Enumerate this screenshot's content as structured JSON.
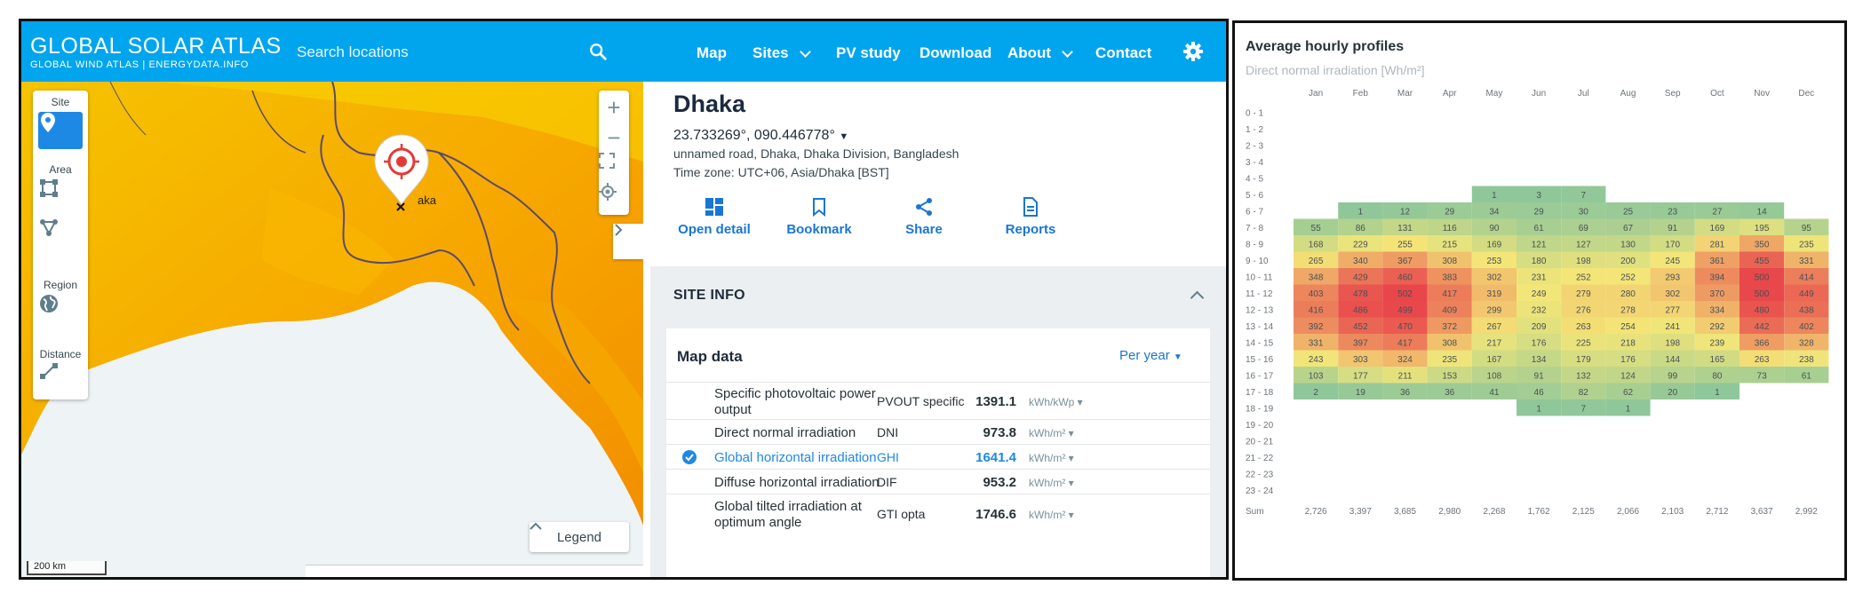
{
  "header": {
    "logo_title": "GLOBAL SOLAR ATLAS",
    "logo_sub": "GLOBAL WIND ATLAS  |  ENERGYDATA.INFO",
    "search_placeholder": "Search locations",
    "nav": [
      {
        "label": "Map",
        "dropdown": false
      },
      {
        "label": "Sites",
        "dropdown": true
      },
      {
        "label": "PV study",
        "dropdown": false
      },
      {
        "label": "Download",
        "dropdown": false
      },
      {
        "label": "About",
        "dropdown": true
      },
      {
        "label": "Contact",
        "dropdown": false
      }
    ],
    "accent_color": "#00a5ee"
  },
  "map": {
    "tools": {
      "site": "Site",
      "area": "Area",
      "region": "Region",
      "distance": "Distance"
    },
    "legend_label": "Legend",
    "scale_label": "200 km",
    "marker_label": "aka",
    "zoom_in": "+",
    "zoom_out": "−"
  },
  "site": {
    "city": "Dhaka",
    "coords": "23.733269°, 090.446778°",
    "address": "unnamed road, Dhaka, Dhaka Division, Bangladesh",
    "timezone": "Time zone: UTC+06, Asia/Dhaka [BST]",
    "actions": [
      "Open detail",
      "Bookmark",
      "Share",
      "Reports"
    ]
  },
  "site_info": {
    "title": "SITE INFO",
    "map_data_title": "Map data",
    "period": "Per year",
    "rows": [
      {
        "name1": "Specific photovoltaic power",
        "name2": "output",
        "abbr": "PVOUT specific",
        "value": "1391.1",
        "unit": "kWh/kWp",
        "highlight": false
      },
      {
        "name1": "Direct normal irradiation",
        "name2": "",
        "abbr": "DNI",
        "value": "973.8",
        "unit": "kWh/m²",
        "highlight": false
      },
      {
        "name1": "Global horizontal irradiation",
        "name2": "",
        "abbr": "GHI",
        "value": "1641.4",
        "unit": "kWh/m²",
        "highlight": true
      },
      {
        "name1": "Diffuse horizontal irradiation",
        "name2": "",
        "abbr": "DIF",
        "value": "953.2",
        "unit": "kWh/m²",
        "highlight": false
      },
      {
        "name1": "Global tilted irradiation at",
        "name2": "optimum angle",
        "abbr": "GTI opta",
        "value": "1746.6",
        "unit": "kWh/m²",
        "highlight": false
      }
    ]
  },
  "chart_data": {
    "type": "heatmap",
    "title": "Average hourly profiles",
    "subtitle": "Direct normal irradiation [Wh/m²]",
    "columns": [
      "Jan",
      "Feb",
      "Mar",
      "Apr",
      "May",
      "Jun",
      "Jul",
      "Aug",
      "Sep",
      "Oct",
      "Nov",
      "Dec"
    ],
    "rows": [
      "0 - 1",
      "1 - 2",
      "2 - 3",
      "3 - 4",
      "4 - 5",
      "5 - 6",
      "6 - 7",
      "7 - 8",
      "8 - 9",
      "9 - 10",
      "10 - 11",
      "11 - 12",
      "12 - 13",
      "13 - 14",
      "14 - 15",
      "15 - 16",
      "16 - 17",
      "17 - 18",
      "18 - 19",
      "19 - 20",
      "20 - 21",
      "21 - 22",
      "22 - 23",
      "23 - 24"
    ],
    "values": [
      [
        null,
        null,
        null,
        null,
        null,
        null,
        null,
        null,
        null,
        null,
        null,
        null
      ],
      [
        null,
        null,
        null,
        null,
        null,
        null,
        null,
        null,
        null,
        null,
        null,
        null
      ],
      [
        null,
        null,
        null,
        null,
        null,
        null,
        null,
        null,
        null,
        null,
        null,
        null
      ],
      [
        null,
        null,
        null,
        null,
        null,
        null,
        null,
        null,
        null,
        null,
        null,
        null
      ],
      [
        null,
        null,
        null,
        null,
        null,
        null,
        null,
        null,
        null,
        null,
        null,
        null
      ],
      [
        null,
        null,
        null,
        null,
        1,
        3,
        7,
        null,
        null,
        null,
        null,
        null
      ],
      [
        null,
        1,
        12,
        29,
        34,
        29,
        30,
        25,
        23,
        27,
        14,
        null
      ],
      [
        55,
        86,
        131,
        116,
        90,
        61,
        69,
        67,
        91,
        169,
        195,
        95
      ],
      [
        168,
        229,
        255,
        215,
        169,
        121,
        127,
        130,
        170,
        281,
        350,
        235
      ],
      [
        265,
        340,
        367,
        308,
        253,
        180,
        198,
        200,
        245,
        361,
        455,
        331
      ],
      [
        348,
        429,
        460,
        383,
        302,
        231,
        252,
        252,
        293,
        394,
        500,
        414
      ],
      [
        403,
        478,
        502,
        417,
        319,
        249,
        279,
        280,
        302,
        370,
        500,
        449
      ],
      [
        416,
        486,
        499,
        409,
        299,
        232,
        276,
        278,
        277,
        334,
        480,
        438
      ],
      [
        392,
        452,
        470,
        372,
        267,
        209,
        263,
        254,
        241,
        292,
        442,
        402
      ],
      [
        331,
        397,
        417,
        308,
        217,
        176,
        225,
        218,
        198,
        239,
        366,
        328
      ],
      [
        243,
        303,
        324,
        235,
        167,
        134,
        179,
        176,
        144,
        165,
        263,
        238
      ],
      [
        103,
        177,
        211,
        153,
        108,
        91,
        132,
        124,
        99,
        80,
        73,
        61
      ],
      [
        2,
        19,
        36,
        36,
        41,
        46,
        82,
        62,
        20,
        1,
        null,
        null
      ],
      [
        null,
        null,
        null,
        null,
        null,
        1,
        7,
        1,
        null,
        null,
        null,
        null
      ],
      [
        null,
        null,
        null,
        null,
        null,
        null,
        null,
        null,
        null,
        null,
        null,
        null
      ],
      [
        null,
        null,
        null,
        null,
        null,
        null,
        null,
        null,
        null,
        null,
        null,
        null
      ],
      [
        null,
        null,
        null,
        null,
        null,
        null,
        null,
        null,
        null,
        null,
        null,
        null
      ],
      [
        null,
        null,
        null,
        null,
        null,
        null,
        null,
        null,
        null,
        null,
        null,
        null
      ],
      [
        null,
        null,
        null,
        null,
        null,
        null,
        null,
        null,
        null,
        null,
        null,
        null
      ]
    ],
    "sum_label": "Sum",
    "sums": [
      "2,726",
      "3,397",
      "3,685",
      "2,980",
      "2,268",
      "1,762",
      "2,125",
      "2,066",
      "2,103",
      "2,712",
      "3,637",
      "2,992"
    ],
    "color_scale": {
      "low": "#8fc79a",
      "mid": "#f4e678",
      "high": "#e8464b"
    },
    "vmax": 502
  }
}
